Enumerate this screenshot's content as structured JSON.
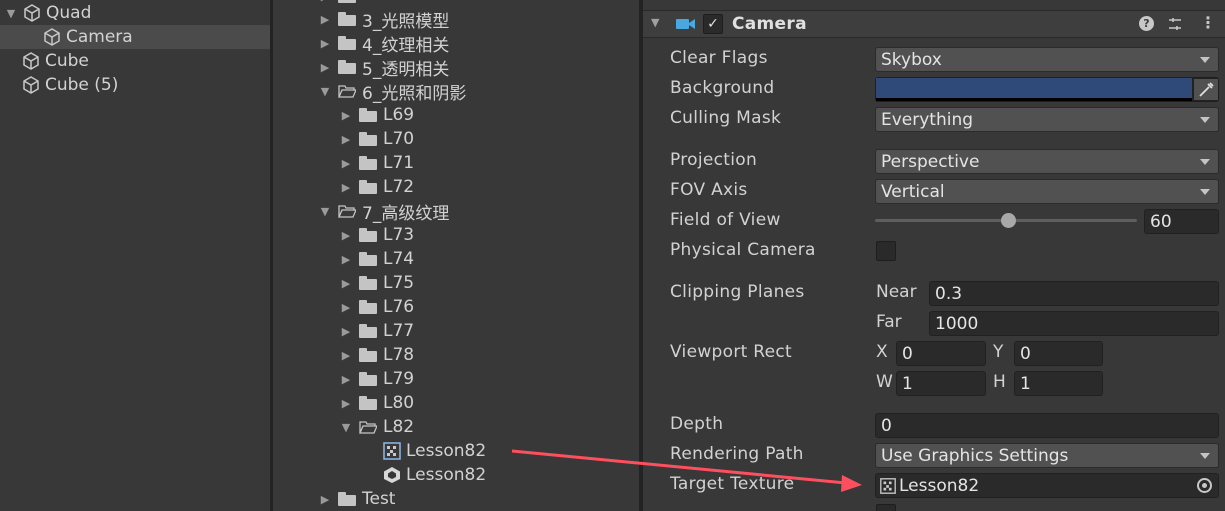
{
  "hierarchy": {
    "items": [
      {
        "label": "Quad",
        "expanded": true
      },
      {
        "label": "Camera",
        "selected": true
      },
      {
        "label": "Cube"
      },
      {
        "label": "Cube (5)"
      }
    ]
  },
  "project": {
    "items": [
      {
        "label": "3_光照模型"
      },
      {
        "label": "4_纹理相关"
      },
      {
        "label": "5_透明相关"
      },
      {
        "label": "6_光照和阴影"
      },
      {
        "label": "L69"
      },
      {
        "label": "L70"
      },
      {
        "label": "L71"
      },
      {
        "label": "L72"
      },
      {
        "label": "7_高级纹理"
      },
      {
        "label": "L73"
      },
      {
        "label": "L74"
      },
      {
        "label": "L75"
      },
      {
        "label": "L76"
      },
      {
        "label": "L77"
      },
      {
        "label": "L78"
      },
      {
        "label": "L79"
      },
      {
        "label": "L80"
      },
      {
        "label": "L82"
      },
      {
        "label": "Lesson82",
        "type": "render-texture"
      },
      {
        "label": "Lesson82",
        "type": "unity-scene"
      },
      {
        "label": "Test"
      }
    ]
  },
  "inspector": {
    "component_title": "Camera",
    "header_icons": [
      "help-icon",
      "presets-icon",
      "more-options-icon"
    ],
    "clear_flags": {
      "label": "Clear Flags",
      "value": "Skybox"
    },
    "background": {
      "label": "Background",
      "color": "#2f4a78"
    },
    "culling_mask": {
      "label": "Culling Mask",
      "value": "Everything"
    },
    "projection": {
      "label": "Projection",
      "value": "Perspective"
    },
    "fov_axis": {
      "label": "FOV Axis",
      "value": "Vertical"
    },
    "field_of_view": {
      "label": "Field of View",
      "value": "60",
      "slider_fraction": 0.51
    },
    "physical_camera": {
      "label": "Physical Camera",
      "checked": false
    },
    "clipping_planes": {
      "label": "Clipping Planes",
      "near_label": "Near",
      "near": "0.3",
      "far_label": "Far",
      "far": "1000"
    },
    "viewport_rect": {
      "label": "Viewport Rect",
      "x_label": "X",
      "x": "0",
      "y_label": "Y",
      "y": "0",
      "w_label": "W",
      "w": "1",
      "h_label": "H",
      "h": "1"
    },
    "depth": {
      "label": "Depth",
      "value": "0"
    },
    "rendering_path": {
      "label": "Rendering Path",
      "value": "Use Graphics Settings"
    },
    "target_texture": {
      "label": "Target Texture",
      "value": "Lesson82"
    },
    "accent_color": "#ff4f5f"
  }
}
